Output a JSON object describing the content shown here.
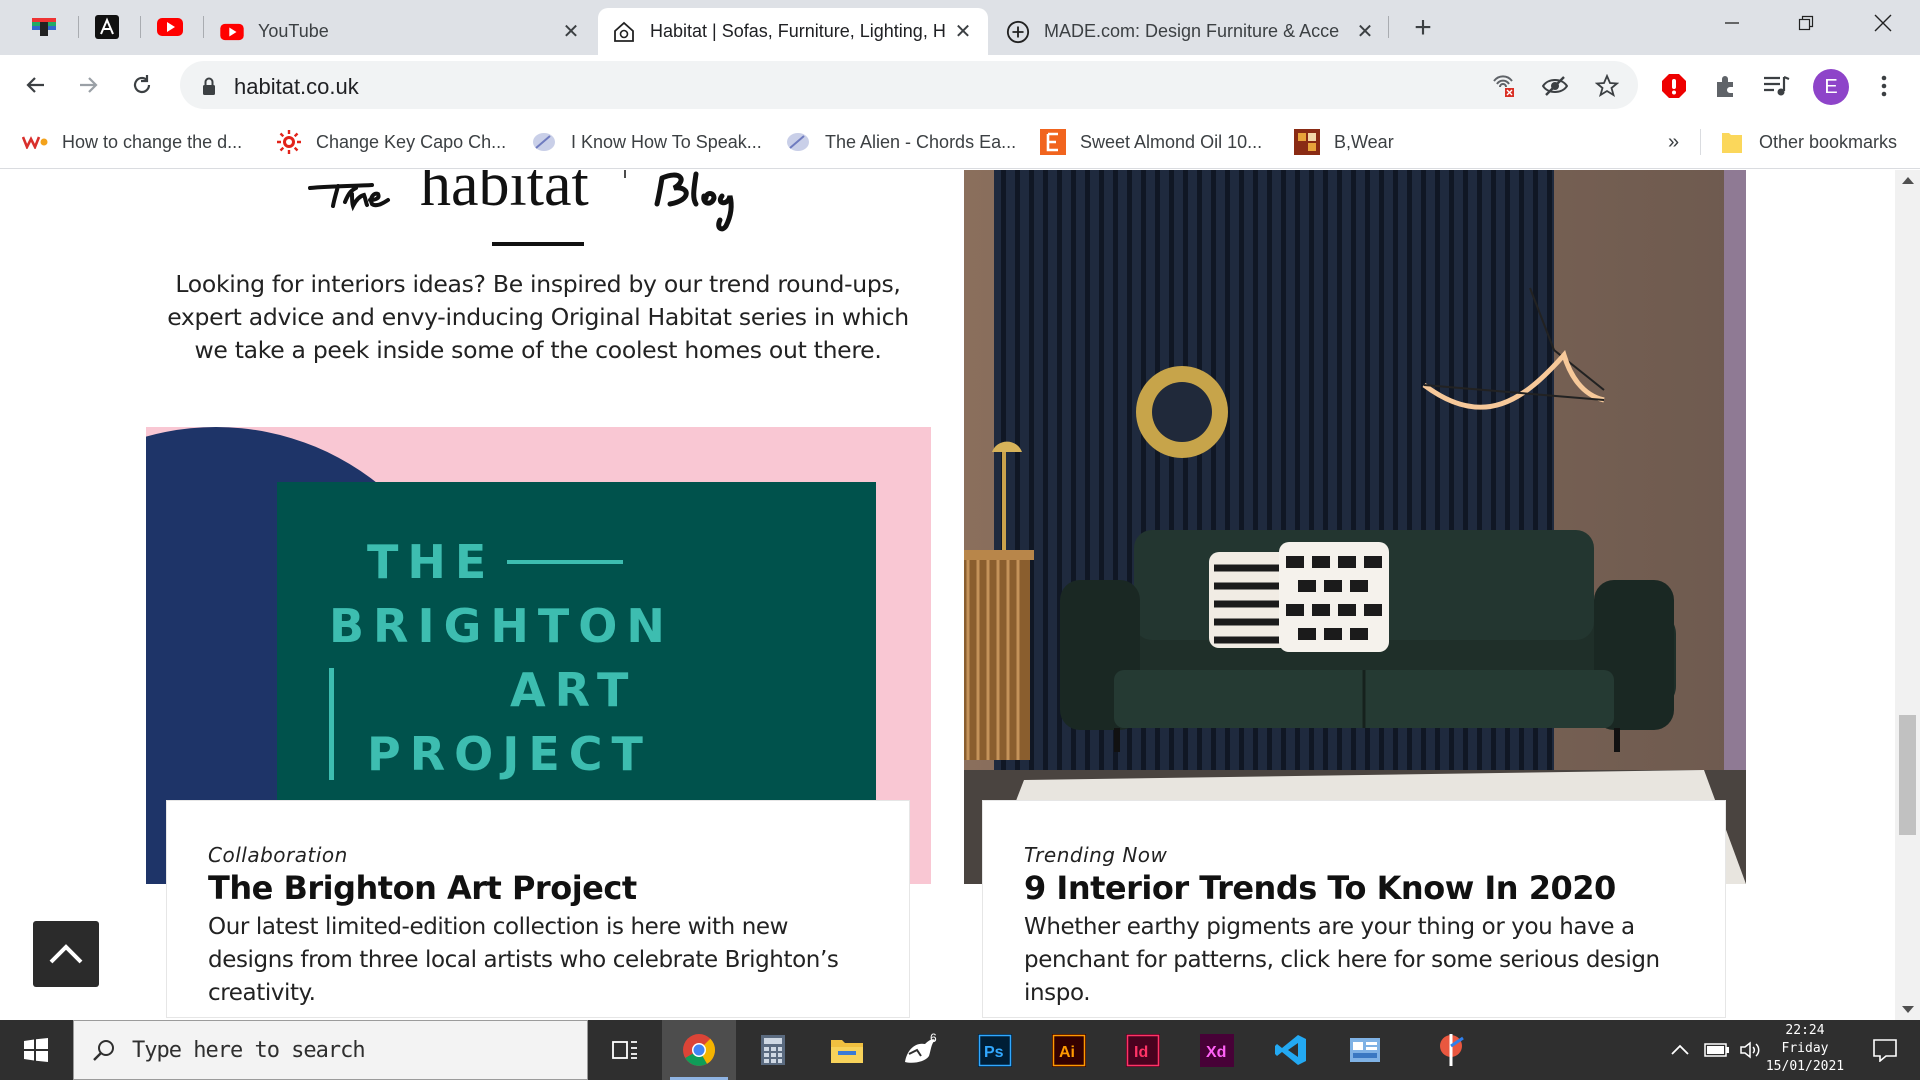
{
  "browser": {
    "tabs": [
      {
        "title": "YouTube",
        "favicon": "youtube-icon"
      },
      {
        "title": "Habitat | Sofas, Furniture, Lighting, H",
        "favicon": "habitat-house-icon",
        "active": true
      },
      {
        "title": "MADE.com: Design Furniture & Acce",
        "favicon": "made-plus-icon"
      }
    ],
    "pinned_tabs": [
      "pinned-app-icon",
      "adobe-icon",
      "youtube-icon"
    ],
    "url": "habitat.co.uk",
    "profile_initial": "E",
    "bookmarks": [
      {
        "label": "How to change the d...",
        "icon": "wix-icon"
      },
      {
        "label": "Change Key Capo Ch...",
        "icon": "sun-icon"
      },
      {
        "label": "I Know How To Speak...",
        "icon": "feather-icon"
      },
      {
        "label": "The Alien - Chords Ea...",
        "icon": "feather-icon"
      },
      {
        "label": "Sweet Almond Oil 10...",
        "icon": "etsy-icon"
      },
      {
        "label": "B,Wear",
        "icon": "bwear-icon"
      }
    ],
    "overflow_label": "»",
    "other_bookmarks": "Other bookmarks"
  },
  "page": {
    "blog_heading_logo": "The habitat Blog",
    "intro": "Looking for interiors ideas? Be inspired by our trend round-ups, expert advice and envy-inducing Original Habitat series in which we take a peek inside some of the coolest homes out there.",
    "cards": [
      {
        "category": "Collaboration",
        "title": "The Brighton Art Project",
        "description": "Our latest limited-edition collection is here with new designs from three local artists who celebrate Brighton’s creativity.",
        "image_text": [
          "THE",
          "BRIGHTON",
          "ART",
          "PROJECT"
        ]
      },
      {
        "category": "Trending Now",
        "title": "9 Interior Trends To Know In 2020",
        "description": "Whether earthy pigments are your thing or you have a penchant for patterns, click here for some serious design inspo."
      }
    ]
  },
  "taskbar": {
    "search_placeholder": "Type here to search",
    "apps": [
      "task-view-icon",
      "chrome-icon",
      "calculator-icon",
      "file-explorer-icon",
      "rhino-icon",
      "photoshop-icon",
      "illustrator-icon",
      "indesign-icon",
      "xd-icon",
      "vscode-icon",
      "control-panel-icon",
      "app-icon"
    ],
    "app_labels": {
      "rhino": "6",
      "ps": "Ps",
      "ai": "Ai",
      "id": "Id",
      "xd": "Xd"
    },
    "time": "22:24",
    "day": "Friday",
    "date": "15/01/2021"
  },
  "colors": {
    "tab_strip": "#dee1e6",
    "pink": "#f9c7d3",
    "navy": "#1e3468",
    "teal": "#00524c",
    "teal_text": "#3dbdb0",
    "taskbar": "#2f2f2f"
  }
}
